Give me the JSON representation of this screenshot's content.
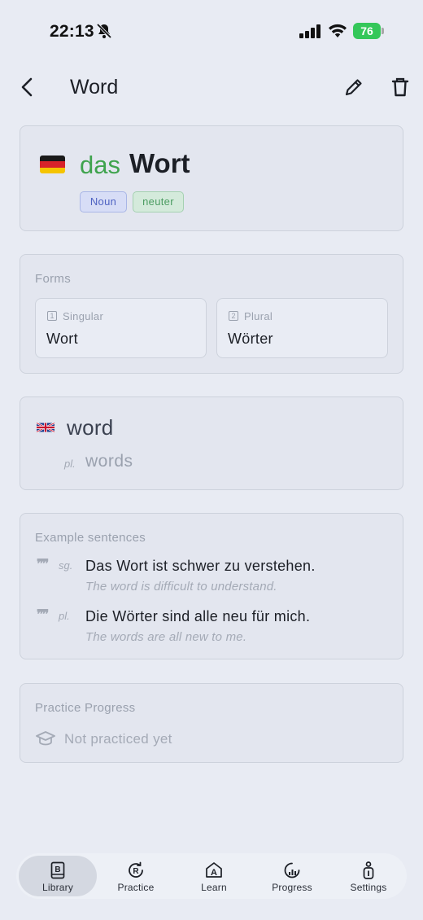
{
  "status_bar": {
    "time": "22:13",
    "battery": "76",
    "icons": [
      "bell-slash-icon",
      "cellular-signal-icon",
      "wifi-icon",
      "battery-charging-icon"
    ]
  },
  "header": {
    "title": "Word",
    "icons": [
      "chevron-left-icon",
      "pencil-icon",
      "trash-icon"
    ]
  },
  "word": {
    "flag": "german-flag-icon",
    "article": "das",
    "headword": "Wort",
    "part_of_speech": "Noun",
    "gender": "neuter",
    "colors": {
      "article": "#3fa34d",
      "noun_badge": "#4f63c2",
      "gender_badge": "#4c9c62"
    }
  },
  "forms": {
    "label": "Forms",
    "singular": {
      "number": "1",
      "label": "Singular",
      "value": "Wort"
    },
    "plural": {
      "number": "2",
      "label": "Plural",
      "value": "Wörter"
    }
  },
  "translation": {
    "flag": "uk-flag-icon",
    "word": "word",
    "plural_tag": "pl.",
    "plural": "words"
  },
  "examples": {
    "label": "Example sentences",
    "items": [
      {
        "tag": "sg.",
        "sentence": "Das Wort ist schwer zu verstehen.",
        "translation": "The word is difficult to understand."
      },
      {
        "tag": "pl.",
        "sentence": "Die Wörter sind alle neu für mich.",
        "translation": "The words are all new to me."
      }
    ]
  },
  "practice_progress": {
    "label": "Practice Progress",
    "status": "Not practiced yet"
  },
  "tabbar": {
    "active": "Library",
    "tabs": [
      {
        "label": "Library",
        "icon": "book-icon"
      },
      {
        "label": "Practice",
        "icon": "practice-icon"
      },
      {
        "label": "Learn",
        "icon": "learn-icon"
      },
      {
        "label": "Progress",
        "icon": "chart-icon"
      },
      {
        "label": "Settings",
        "icon": "settings-icon"
      }
    ]
  }
}
